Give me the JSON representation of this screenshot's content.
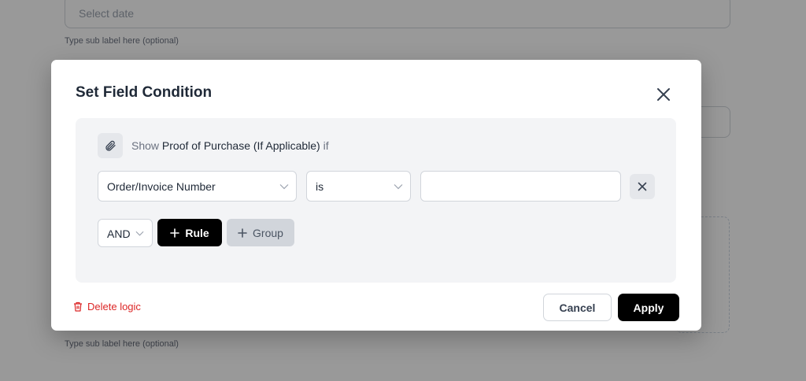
{
  "background": {
    "date_placeholder": "Select date",
    "sub_label_top": "Type sub label here (optional)",
    "sub_label_bottom": "Type sub label here (optional)"
  },
  "modal": {
    "title": "Set Field Condition",
    "close_icon": "close-icon",
    "condition": {
      "icon": "paperclip-icon",
      "show_label": "Show",
      "field_name": "Proof of Purchase (If Applicable)",
      "if_label": "if"
    },
    "rule": {
      "field": "Order/Invoice Number",
      "operator": "is",
      "value": "",
      "remove_icon": "close-icon"
    },
    "logic_operator": "AND",
    "add_rule_label": "Rule",
    "add_group_label": "Group",
    "delete_logic_label": "Delete logic",
    "cancel_label": "Cancel",
    "apply_label": "Apply"
  },
  "colors": {
    "primary": "#000000",
    "danger": "#dc2626",
    "card_bg": "#f3f4f6"
  }
}
